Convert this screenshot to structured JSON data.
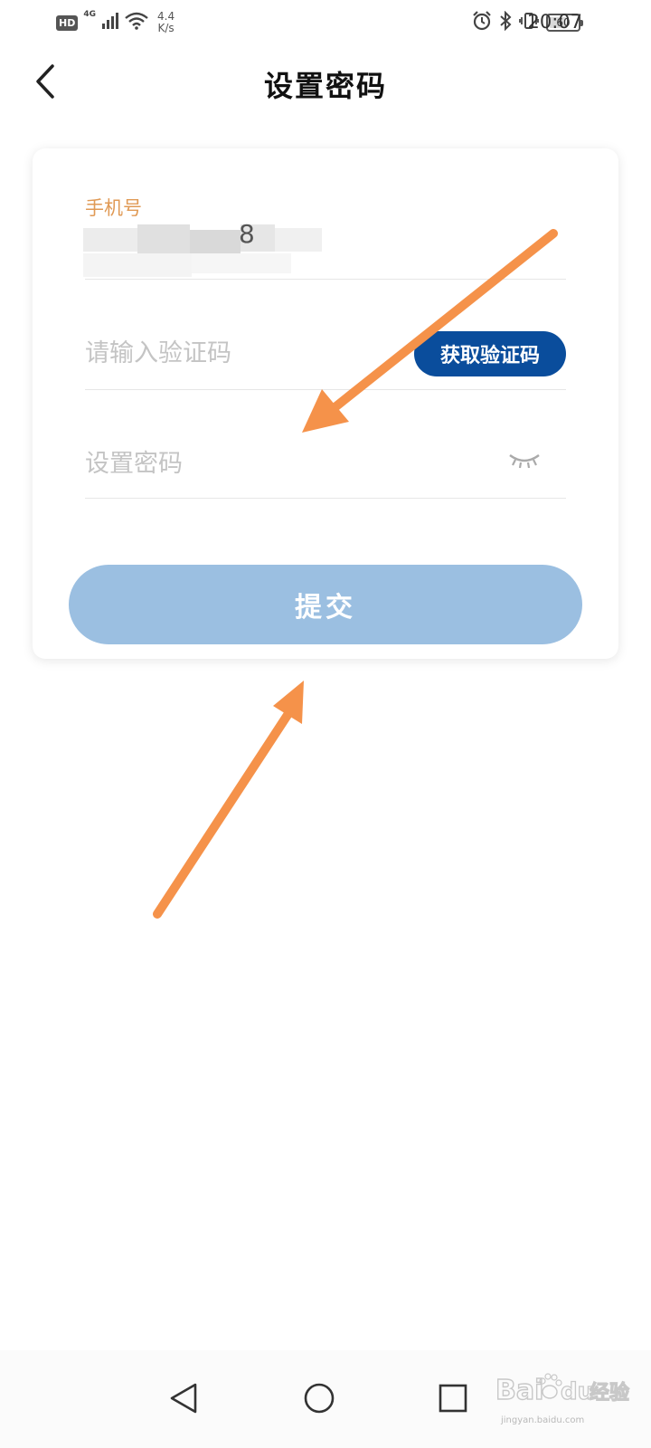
{
  "status_bar": {
    "hd": "HD",
    "network": "4G",
    "speed_value": "4.4",
    "speed_unit": "K/s",
    "battery": "60",
    "battery_level": 0.6,
    "time": "20:07"
  },
  "header": {
    "title": "设置密码",
    "back_icon": "chevron-left-icon"
  },
  "form": {
    "phone_label": "手机号",
    "phone_value_visible": "8",
    "code_placeholder": "请输入验证码",
    "get_code_label": "获取验证码",
    "password_placeholder": "设置密码",
    "eye_icon": "eye-closed-icon",
    "submit_label": "提交"
  },
  "nav_bar": {
    "back_icon": "triangle-back-icon",
    "home_icon": "circle-home-icon",
    "recents_icon": "square-recents-icon"
  },
  "watermark": {
    "brand": "Bai",
    "brand_suffix": "du",
    "product": "经验",
    "url": "jingyan.baidu.com"
  },
  "colors": {
    "label_orange": "#e09a55",
    "get_code_blue": "#0a4d9c",
    "submit_blue": "#9bbfe1",
    "arrow_orange": "#f5924a",
    "placeholder_gray": "#c4c4c4"
  }
}
